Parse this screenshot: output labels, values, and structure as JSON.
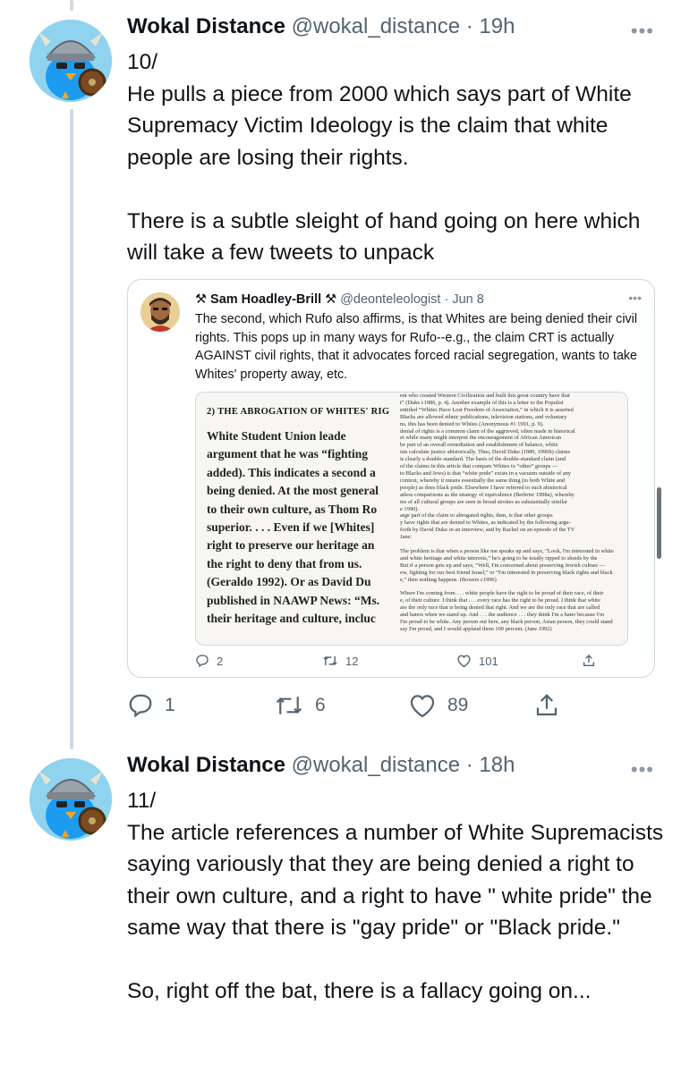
{
  "tweets": [
    {
      "name": "Wokal Distance",
      "handle": "@wokal_distance",
      "time": "· 19h",
      "more": "•••",
      "text": "10/\nHe pulls a piece from 2000 which says part of White Supremacy Victim Ideology is the claim that white people are losing their rights.\n\nThere is a subtle sleight of hand going on here which will take a few tweets to unpack",
      "replies": "1",
      "retweets": "6",
      "likes": "89"
    },
    {
      "name": "Wokal Distance",
      "handle": "@wokal_distance",
      "time": "· 18h",
      "more": "•••",
      "text": "11/\nThe article references a number of White Supremacists saying variously that they are being denied a right to their own culture, and a right to have \" white pride\" the same way that there is \"gay pride\" or \"Black pride.\"\n\nSo, right off the bat, there is a fallacy going on..."
    }
  ],
  "quoted": {
    "name": "⚒ Sam Hoadley-Brill ⚒",
    "handle": "@deonteleologist",
    "time": "· Jun 8",
    "more": "•••",
    "text": "The second, which Rufo also affirms, is that Whites are being denied their civil rights. This pops up in many ways for Rufo--e.g., the claim CRT is actually AGAINST civil rights, that it advocates forced racial segregation, wants to take Whites' property away, etc.",
    "replies": "2",
    "retweets": "12",
    "likes": "101",
    "image": {
      "heading": "2) THE ABROGATION OF WHITES' RIG",
      "left_lines": [
        "      White Student Union leade",
        "argument that he was “fighting",
        "added). This indicates a second a",
        "being denied. At the most general",
        "to their own culture, as Thom Ro",
        "superior. . . . Even if we [Whites]",
        "right to preserve our heritage an",
        "the right to deny that from us.",
        "(Geraldo 1992). Or as David Du",
        "published in NAAWP News: “Ms.",
        "their heritage and culture, incluc"
      ],
      "right_lines": [
        "ent who created Western Civilization and built this great country have that",
        "t” (Duke c1986, p. 4). Another example of this is a letter to the Populist",
        "entitled “Whites Have Lost Freedom of Association,” in which it is asserted",
        "Blacks are allowed ethnic publications, television stations, and voluntary",
        "ns, this has been denied to Whites (Anonymous #1 1991, p. 9).",
        "denial of rights is a common claim of the aggrieved, often made in historical",
        "et while many might interpret the encouragement of African American",
        "be part of an overall remediation and establishment of balance, white",
        "ists calculate justice ahistorically. Thus, David Duke (1989, 1990b) claims",
        "is clearly a double standard. The basis of the double-standard claim (and",
        "of the claims in this article that compare Whites to “other” groups —",
        "to Blacks and Jews) is that “white pride” exists in a vacuum outside of any",
        "context, whereby it means essentially the same thing (to both White and",
        "people) as does black pride. Elsewhere I have referred to such ahistorical",
        "atless comparisons as the strategy of equivalence (Berbrier 1998a), whereby",
        "ies of all cultural groups are seen in broad strokes as substantially similar",
        "e 1990).",
        "arge part of the claim to abrogated rights, then, is that other groups",
        "y have rights that are denied to Whites, as indicated by the following argu-",
        "forth by David Duke in an interview, and by Rachel on an episode of the TV",
        "Jane:",
        "",
        "The problem is that when a person like me speaks up and says, “Look, I'm interested in white",
        "and white heritage and white interests,” he's going to be totally ripped to shreds by the",
        "But if a person gets up and says, “Well, I'm concerned about preserving Jewish culture —",
        "ew, fighting for our best friend Israel,” or “I'm interested in preserving black rights and black",
        "e,” then nothing happens. (Bowers c1996)",
        "",
        "Where I'm coming from . . . white people have the right to be proud of their race, of their",
        "e, of their culture. I think that . . . every race has the right to be proud. I think that white",
        "are the only race that is being denied that right. And we are the only race that are called",
        "and haters when we stand up. And . . . the audience . . . they think I'm a hater because I'm",
        "I'm proud to be white. Any person out here, any black person, Asian person, they could stand",
        "say I'm proud, and I would applaud them 100 percent. (Jane 1992)"
      ]
    }
  }
}
